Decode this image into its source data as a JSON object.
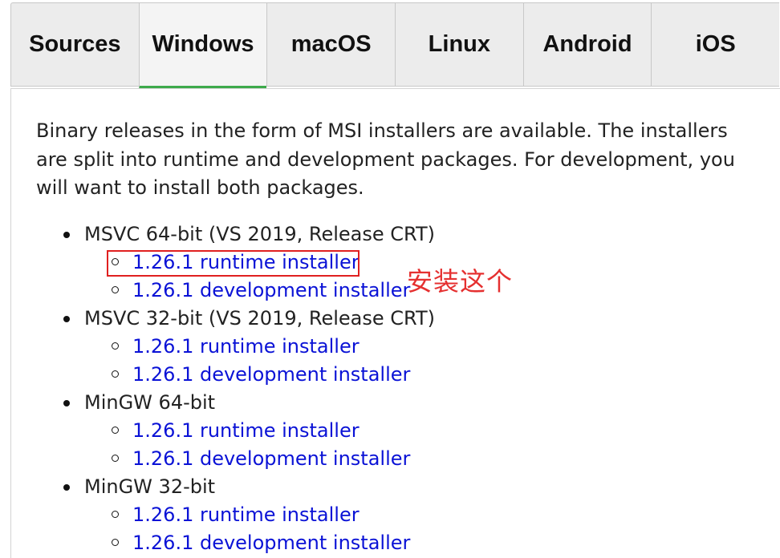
{
  "tabs": [
    {
      "label": "Sources"
    },
    {
      "label": "Windows",
      "active": true
    },
    {
      "label": "macOS"
    },
    {
      "label": "Linux"
    },
    {
      "label": "Android"
    },
    {
      "label": "iOS"
    }
  ],
  "panel": {
    "intro": "Binary releases in the form of MSI installers are available. The installers are split into runtime and development packages. For development, you will want to install both packages."
  },
  "platforms": [
    {
      "name": "MSVC 64-bit (VS 2019, Release CRT)",
      "links": [
        "1.26.1 runtime installer",
        "1.26.1 development installer"
      ]
    },
    {
      "name": "MSVC 32-bit (VS 2019, Release CRT)",
      "links": [
        "1.26.1 runtime installer",
        "1.26.1 development installer"
      ]
    },
    {
      "name": "MinGW 64-bit",
      "links": [
        "1.26.1 runtime installer",
        "1.26.1 development installer"
      ]
    },
    {
      "name": "MinGW 32-bit",
      "links": [
        "1.26.1 runtime installer",
        "1.26.1 development installer"
      ]
    }
  ],
  "annotation": {
    "text": "安装这个",
    "color": "#e53030"
  },
  "colors": {
    "link": "#0a12d6",
    "active_tab_underline": "#3daa4b",
    "highlight": "#e02020"
  }
}
